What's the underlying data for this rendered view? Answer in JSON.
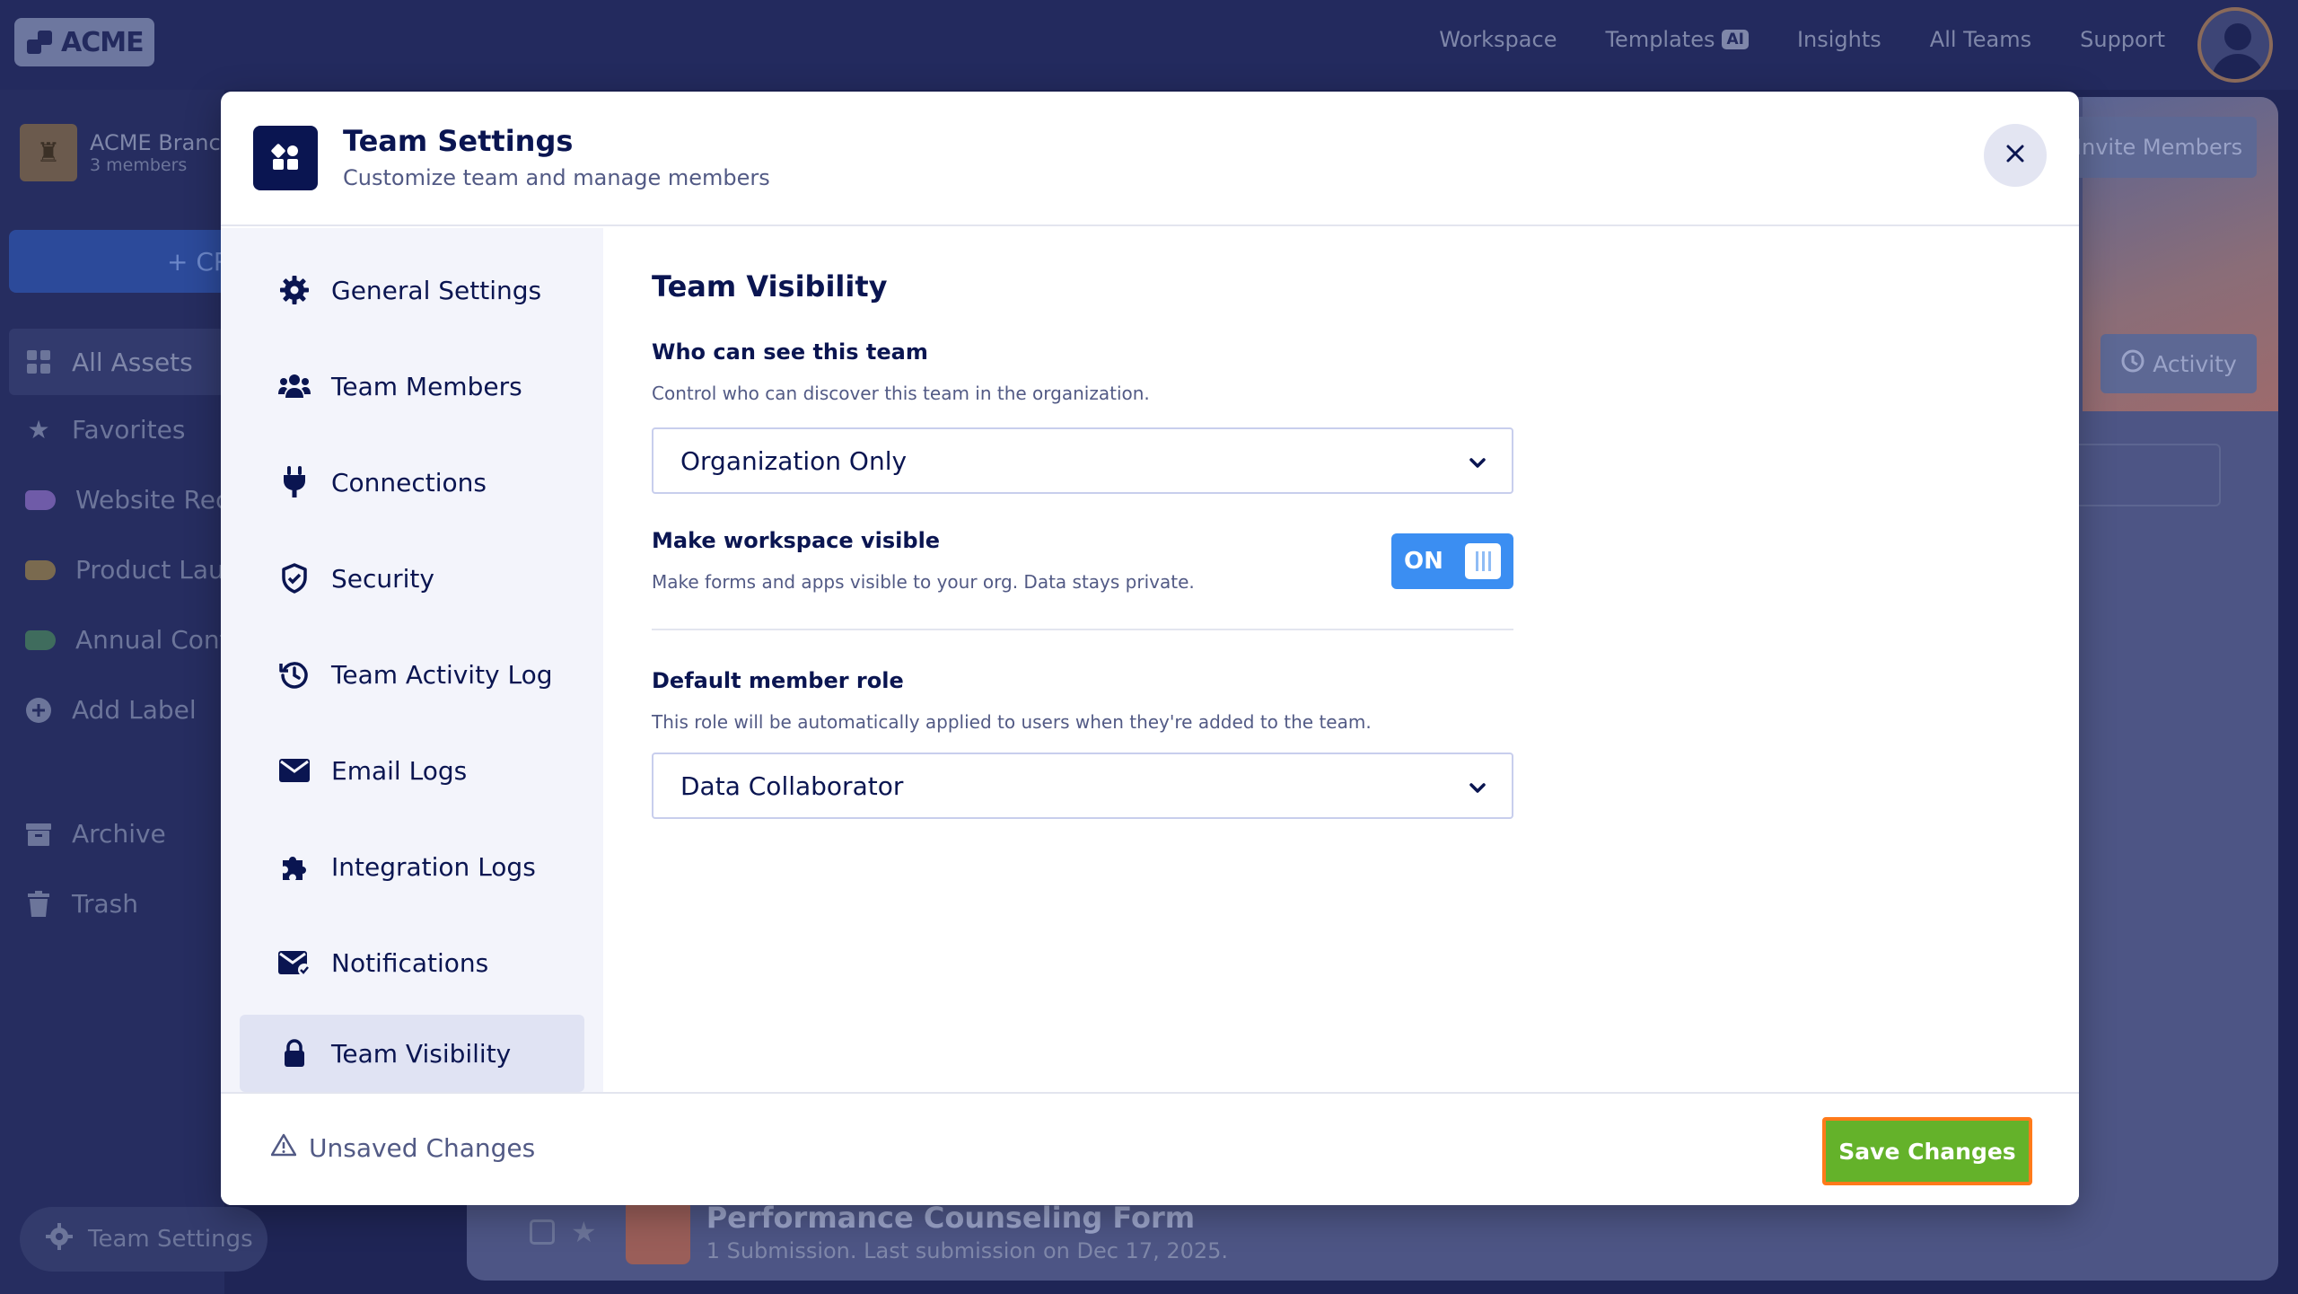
{
  "app": {
    "logo_text": "ACME",
    "nav": [
      {
        "label": "Workspace"
      },
      {
        "label": "Templates",
        "badge": "AI"
      },
      {
        "label": "Insights"
      },
      {
        "label": "All Teams"
      },
      {
        "label": "Support"
      }
    ]
  },
  "sidebar": {
    "team_name": "ACME Branc",
    "team_members": "3 members",
    "create_label": "+ CR",
    "items": [
      {
        "label": "All Assets",
        "icon": "grid-icon"
      },
      {
        "label": "Favorites",
        "icon": "star-icon"
      },
      {
        "label": "Website Rec",
        "icon": "label-icon",
        "color": "#6f5ba8"
      },
      {
        "label": "Product Laun",
        "icon": "label-icon",
        "color": "#7a6a4f"
      },
      {
        "label": "Annual Conf",
        "icon": "label-icon",
        "color": "#3f6c5d"
      },
      {
        "label": "Add Label",
        "icon": "plus-circle-icon"
      },
      {
        "label": "Archive",
        "icon": "archive-icon"
      },
      {
        "label": "Trash",
        "icon": "trash-icon"
      }
    ],
    "team_settings_label": "Team Settings"
  },
  "background": {
    "invite_label": "Invite Members",
    "activity_label": "Activity",
    "form_title": "Performance Counseling Form",
    "form_subtitle": "1 Submission.  Last submission on Dec 17, 2025."
  },
  "modal": {
    "title": "Team Settings",
    "subtitle": "Customize team and manage members",
    "nav": [
      {
        "label": "General Settings",
        "icon": "gear-icon"
      },
      {
        "label": "Team Members",
        "icon": "users-icon"
      },
      {
        "label": "Connections",
        "icon": "plug-icon"
      },
      {
        "label": "Security",
        "icon": "shield-icon"
      },
      {
        "label": "Team Activity Log",
        "icon": "history-icon"
      },
      {
        "label": "Email Logs",
        "icon": "envelope-icon"
      },
      {
        "label": "Integration Logs",
        "icon": "puzzle-icon"
      },
      {
        "label": "Notifications",
        "icon": "mail-notification-icon"
      },
      {
        "label": "Team Visibility",
        "icon": "lock-icon",
        "active": true
      }
    ],
    "content": {
      "section_title": "Team Visibility",
      "who_label": "Who can see this team",
      "who_desc": "Control who can discover this team in the organization.",
      "who_value": "Organization Only",
      "visible_label": "Make workspace visible",
      "visible_desc": "Make forms and apps visible to your org. Data stays private.",
      "visible_toggle": "ON",
      "role_label": "Default member role",
      "role_desc": "This role will be automatically applied to users when they're added to the team.",
      "role_value": "Data Collaborator"
    },
    "footer": {
      "unsaved_label": "Unsaved Changes",
      "save_label": "Save Changes"
    }
  },
  "colors": {
    "navy": "#0a1551",
    "toggle_blue": "#3b8ef2",
    "save_green": "#64b22a",
    "highlight_orange": "#ff7a1a"
  }
}
